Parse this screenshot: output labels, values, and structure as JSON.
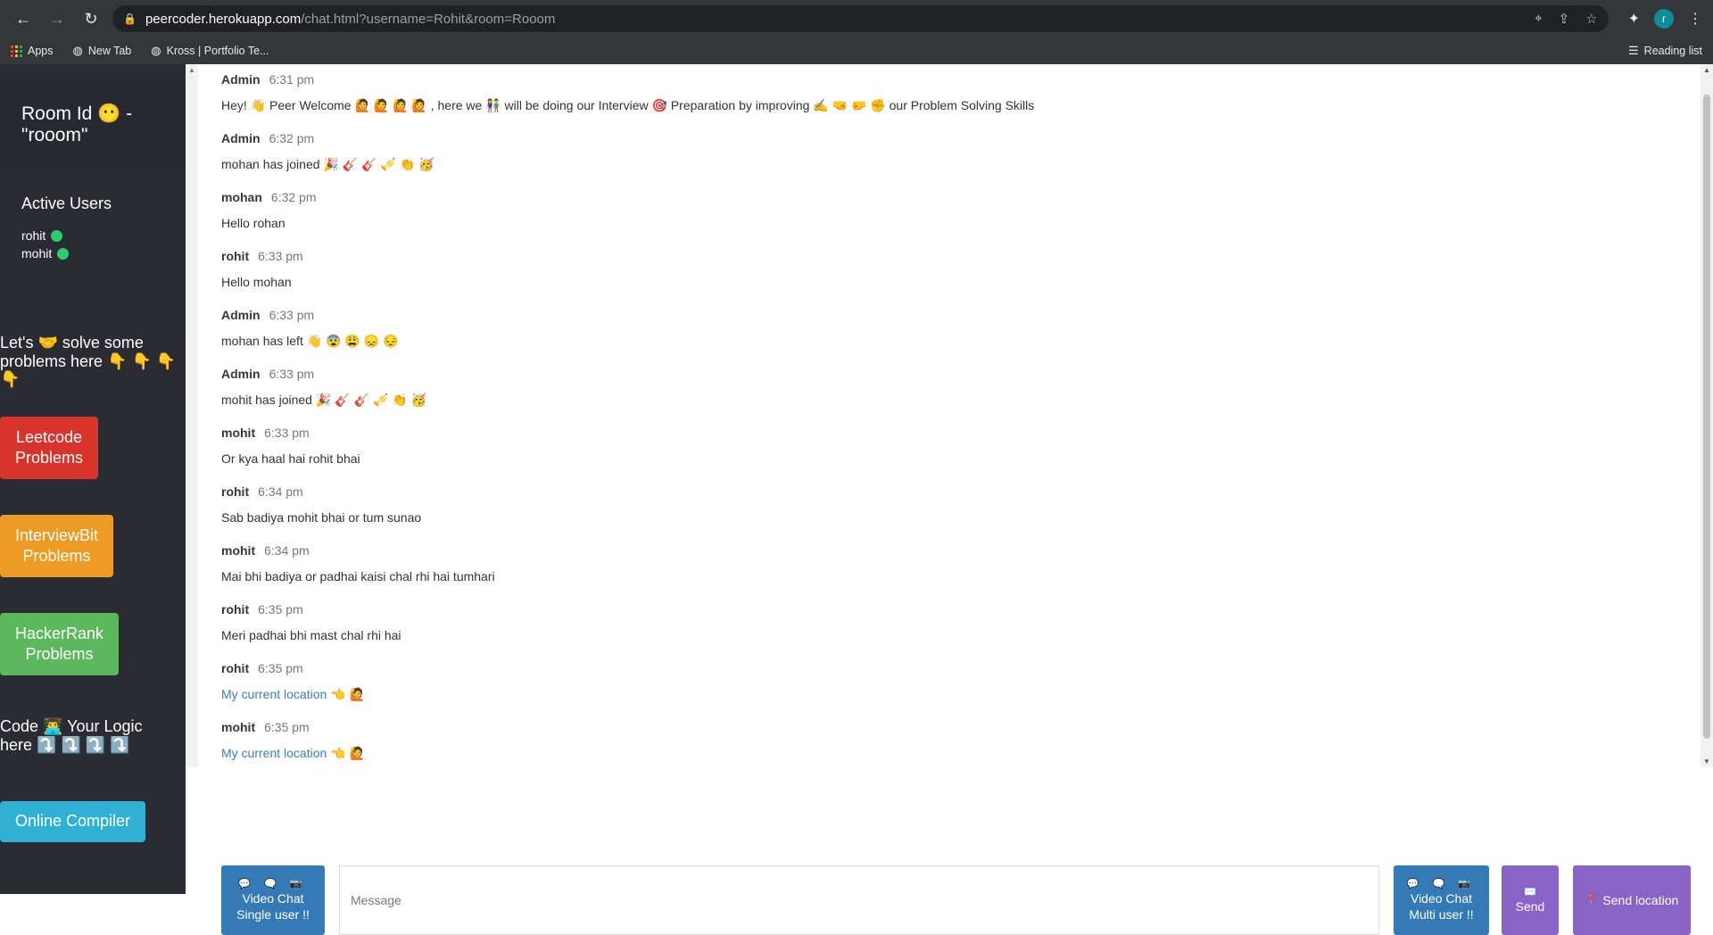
{
  "browser": {
    "url_host": "peercoder.herokuapp.com",
    "url_path": "/chat.html?username=Rohit&room=Rooom",
    "profile_initial": "r",
    "bookmarks": [
      {
        "label": "Apps"
      },
      {
        "label": "New Tab"
      },
      {
        "label": "Kross | Portfolio Te..."
      }
    ],
    "reading_list": "Reading list"
  },
  "sidebar": {
    "room_label": "Room Id 😶 - \"rooom\"",
    "active_users_title": "Active Users",
    "users": [
      "rohit",
      "mohit"
    ],
    "lets_solve": "Let's 🤝 solve some problems here 👇 👇 👇 👇",
    "leetcode_label": "Leetcode Problems",
    "interviewbit_label": "InterviewBit Problems",
    "hackerrank_label": "HackerRank Problems",
    "code_here": "Code 👨‍💻 Your Logic here ⤵️ ⤵️ ⤵️ ⤵️",
    "compiler_label": "Online Compiler",
    "colors": {
      "leetcode": "#d9342c",
      "interviewbit": "#ec9b25",
      "hackerrank": "#5cb85c",
      "compiler": "#31b0d5",
      "online_dot": "#2ecc71"
    }
  },
  "messages": [
    {
      "name": "Admin",
      "time": "6:31 pm",
      "text": "Hey! 👋 Peer Welcome 🙋 🙋 🙋 🙋 , here we 👫 will be doing our Interview 🎯 Preparation by improving ✍️ 🤜 🤛 ✊ our Problem Solving Skills",
      "link": false
    },
    {
      "name": "Admin",
      "time": "6:32 pm",
      "text": "mohan has joined 🎉 🎸 🎸 🎺 👏 🥳",
      "link": false
    },
    {
      "name": "mohan",
      "time": "6:32 pm",
      "text": "Hello rohan",
      "link": false
    },
    {
      "name": "rohit",
      "time": "6:33 pm",
      "text": "Hello mohan",
      "link": false
    },
    {
      "name": "Admin",
      "time": "6:33 pm",
      "text": "mohan has left 👋 😨 😩 😞 😔",
      "link": false
    },
    {
      "name": "Admin",
      "time": "6:33 pm",
      "text": "mohit has joined 🎉 🎸 🎸 🎺 👏 🥳",
      "link": false
    },
    {
      "name": "mohit",
      "time": "6:33 pm",
      "text": "Or kya haal hai rohit bhai",
      "link": false
    },
    {
      "name": "rohit",
      "time": "6:34 pm",
      "text": "Sab badiya mohit bhai or tum sunao",
      "link": false
    },
    {
      "name": "mohit",
      "time": "6:34 pm",
      "text": "Mai bhi badiya or padhai kaisi chal rhi hai tumhari",
      "link": false
    },
    {
      "name": "rohit",
      "time": "6:35 pm",
      "text": "Meri padhai bhi mast chal rhi hai",
      "link": false
    },
    {
      "name": "rohit",
      "time": "6:35 pm",
      "text": "My current location 👈 🙋",
      "link": true
    },
    {
      "name": "mohit",
      "time": "6:35 pm",
      "text": "My current location 👈 🙋",
      "link": true
    }
  ],
  "composer": {
    "video_single_icons": "💬 🗨️ 📷",
    "video_single_label": "Video Chat Single user !!",
    "placeholder": "Message",
    "video_multi_icons": "💬 🗨️ 📷",
    "video_multi_label": "Video Chat Multi user !!",
    "send_icon": "✉️",
    "send_label": "Send",
    "send_location_icon": "📍",
    "send_location_label": "Send location"
  }
}
